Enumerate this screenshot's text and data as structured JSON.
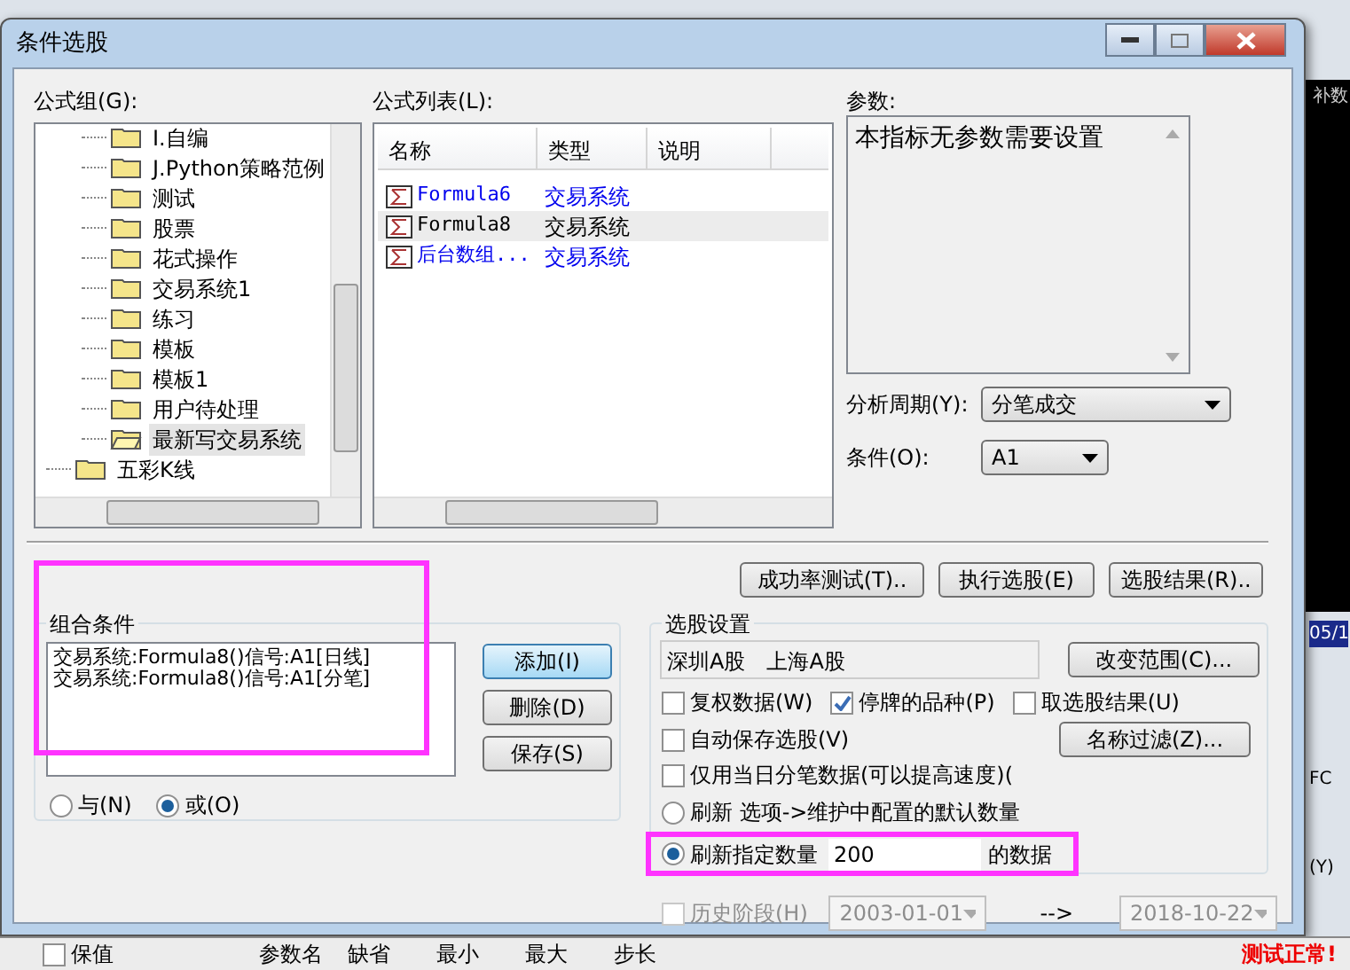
{
  "window": {
    "title": "条件选股"
  },
  "formula_group": {
    "label": "公式组(G):",
    "items": [
      {
        "children": [
          {
            "label": "I.自编",
            "selected": false
          },
          {
            "label": "J.Python策略范例",
            "selected": false
          },
          {
            "label": "测试",
            "selected": false
          },
          {
            "label": "股票",
            "selected": false
          },
          {
            "label": "花式操作",
            "selected": false
          },
          {
            "label": "交易系统1",
            "selected": false
          },
          {
            "label": "练习",
            "selected": false
          },
          {
            "label": "模板",
            "selected": false
          },
          {
            "label": "模板1",
            "selected": false
          },
          {
            "label": "用户待处理",
            "selected": false
          },
          {
            "label": "最新写交易系统",
            "selected": true
          }
        ]
      },
      {
        "label": "五彩K线",
        "selected": false
      }
    ]
  },
  "formula_list": {
    "label": "公式列表(L):",
    "columns": [
      "名称",
      "类型",
      "说明"
    ],
    "rows": [
      {
        "name": "Formula6",
        "type": "交易系统",
        "selected": false
      },
      {
        "name": "Formula8",
        "type": "交易系统",
        "selected": true
      },
      {
        "name": "后台数组...",
        "type": "交易系统",
        "selected": false
      }
    ]
  },
  "params": {
    "label": "参数:",
    "text": "本指标无参数需要设置"
  },
  "period": {
    "label": "分析周期(Y):",
    "value": "分笔成交"
  },
  "condition": {
    "label": "条件(O):",
    "value": "A1"
  },
  "action_buttons": [
    "成功率测试(T)..",
    "执行选股(E)",
    "选股结果(R).."
  ],
  "combo": {
    "label": "组合条件",
    "lines": [
      "交易系统:Formula8()信号:A1[日线]",
      "交易系统:Formula8()信号:A1[分笔]"
    ],
    "buttons": [
      {
        "label": "添加(I)",
        "selected": true
      },
      {
        "label": "删除(D)",
        "selected": false
      },
      {
        "label": "保存(S)",
        "selected": false
      }
    ],
    "radios": [
      {
        "label": "与(N)",
        "selected": false
      },
      {
        "label": "或(O)",
        "selected": true
      }
    ]
  },
  "settings": {
    "label": "选股设置",
    "scope": "深圳A股　上海A股",
    "scope_button": "改变范围(C)...",
    "filter_button": "名称过滤(Z)...",
    "checkboxes": [
      {
        "label": "复权数据(W)",
        "checked": false
      },
      {
        "label": "停牌的品种(P)",
        "checked": true
      },
      {
        "label": "取选股结果(U)",
        "checked": false
      },
      {
        "label": "自动保存选股(V)",
        "checked": false
      },
      {
        "label": "仅用当日分笔数据(可以提高速度)(",
        "checked": false
      }
    ],
    "radios": [
      {
        "label": "刷新 选项->维护中配置的默认数量",
        "selected": false
      },
      {
        "label": "刷新指定数量",
        "selected": true,
        "value": "200",
        "suffix": "的数据"
      }
    ]
  },
  "history": {
    "label": "历史阶段(H)",
    "checked": false,
    "disabled": true,
    "from": "2003-01-01",
    "arrow": "-->",
    "to": "2018-10-22"
  },
  "background": {
    "side_texts": [
      "补数",
      "05/1",
      "FC",
      "(Y)"
    ],
    "status": "测试正常!",
    "checkbox": {
      "label": "保值",
      "checked": false
    },
    "columns": [
      "参数名",
      "缺省",
      "最小",
      "最大",
      "步长"
    ]
  }
}
